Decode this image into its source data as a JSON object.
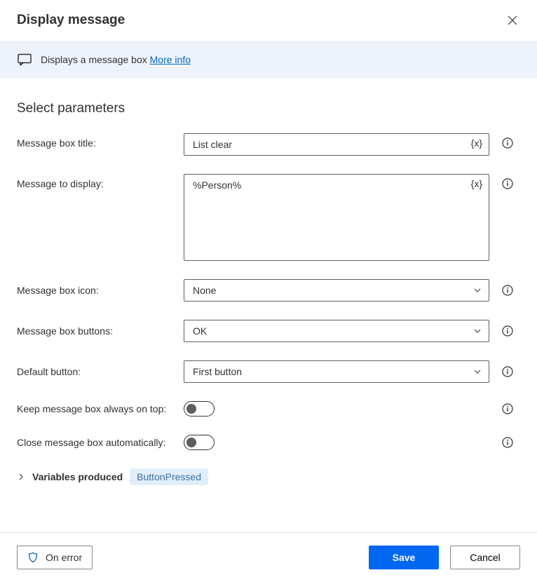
{
  "header": {
    "title": "Display message"
  },
  "banner": {
    "text": "Displays a message box",
    "more_info": "More info"
  },
  "section_title": "Select parameters",
  "params": {
    "title_label": "Message box title:",
    "title_value": "List clear",
    "message_label": "Message to display:",
    "message_value": "%Person%",
    "icon_label": "Message box icon:",
    "icon_value": "None",
    "buttons_label": "Message box buttons:",
    "buttons_value": "OK",
    "default_label": "Default button:",
    "default_value": "First button",
    "ontop_label": "Keep message box always on top:",
    "autoclose_label": "Close message box automatically:"
  },
  "variables": {
    "label": "Variables produced",
    "chip": "ButtonPressed"
  },
  "footer": {
    "on_error": "On error",
    "save": "Save",
    "cancel": "Cancel"
  },
  "glyphs": {
    "var_token": "{x}"
  }
}
